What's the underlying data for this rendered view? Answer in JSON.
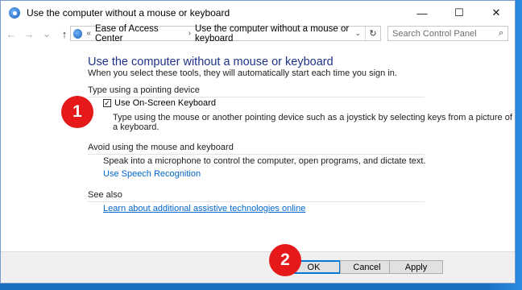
{
  "window": {
    "title": "Use the computer without a mouse or keyboard",
    "controls": {
      "minimize": "—",
      "maximize": "☐",
      "close": "✕"
    }
  },
  "nav": {
    "back": "←",
    "forward": "→",
    "recent": "⌄",
    "up": "↑"
  },
  "address": {
    "prefix": "«",
    "crumbs": [
      "Ease of Access Center",
      "Use the computer without a mouse or keyboard"
    ],
    "separator": "›",
    "refresh": "↻"
  },
  "search": {
    "placeholder": "Search Control Panel",
    "icon": "⌕"
  },
  "main": {
    "title": "Use the computer without a mouse or keyboard",
    "subtitle": "When you select these tools, they will automatically start each time you sign in.",
    "section_pointing": "Type using a pointing device",
    "osk_label": "Use On-Screen Keyboard",
    "osk_checked": true,
    "osk_check_glyph": "✓",
    "osk_desc_line1": "Type using the mouse or another pointing device such as a joystick by selecting keys from a picture of",
    "osk_desc_line2": "a keyboard.",
    "section_avoid": "Avoid using the mouse and keyboard",
    "speech_desc": "Speak into a microphone to control the computer, open programs, and dictate text.",
    "speech_link": "Use Speech Recognition",
    "section_seealso": "See also",
    "seealso_link": "Learn about additional assistive technologies online"
  },
  "footer": {
    "ok": "OK",
    "cancel": "Cancel",
    "apply": "Apply"
  },
  "markers": {
    "one": "1",
    "two": "2"
  },
  "colors": {
    "marker": "#e51919",
    "link": "#0066cc",
    "title": "#1e3287",
    "desktop": "#1b6fc2"
  }
}
